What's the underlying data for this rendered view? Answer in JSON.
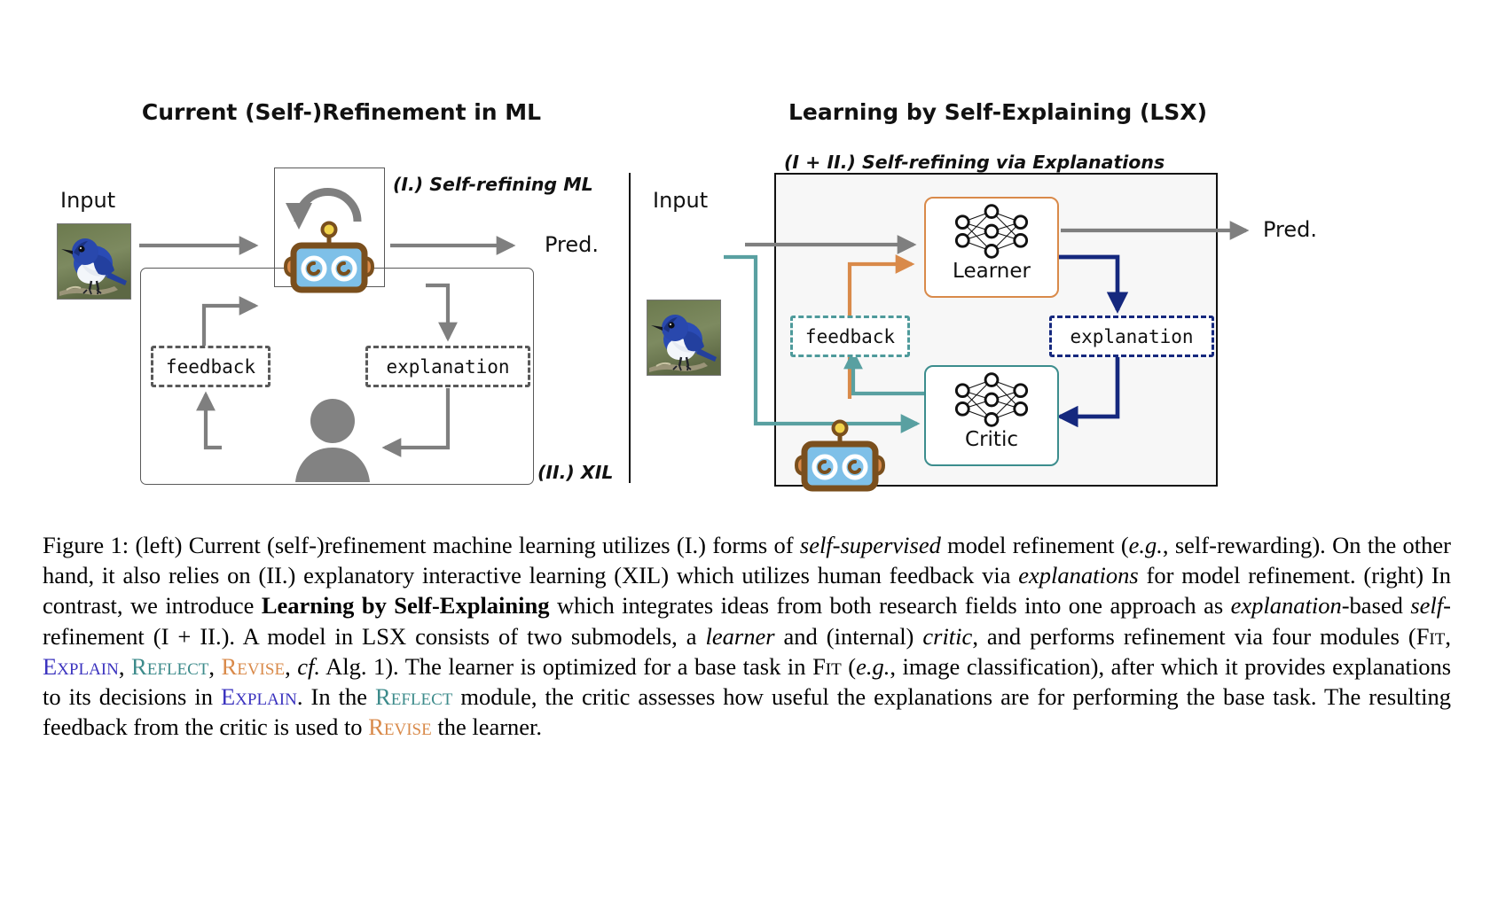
{
  "figure": {
    "left_panel": {
      "title": "Current (Self-)Refinement in ML",
      "input_label": "Input",
      "pred_label": "Pred.",
      "part_one_label": "(I.) Self-refining ML",
      "part_two_label": "(II.) XIL",
      "feedback_label": "feedback",
      "explanation_label": "explanation",
      "icons": {
        "model": "robot-icon",
        "human": "person-icon",
        "loop": "circular-refresh-arrow-icon",
        "input_image": "blue-flycatcher-bird-photo"
      }
    },
    "right_panel": {
      "title": "Learning by Self-Explaining (LSX)",
      "subtitle": "(I + II.) Self-refining via Explanations",
      "input_label": "Input",
      "pred_label": "Pred.",
      "learner_label": "Learner",
      "critic_label": "Critic",
      "feedback_label": "feedback",
      "explanation_label": "explanation",
      "icons": {
        "learner": "neural-network-icon",
        "critic": "neural-network-icon",
        "model": "robot-icon",
        "input_image": "blue-flycatcher-bird-photo"
      }
    },
    "colors": {
      "gray_arrow": "#7f7f7f",
      "orange": "#d98a4a",
      "teal": "#4e9a9b",
      "navy": "#15287e",
      "robot_body": "#7ec0e8",
      "robot_outline": "#7a4f1d",
      "robot_ear": "#d98a4a",
      "antenna_ball": "#f0d24a",
      "explain_color": "#3b33bf",
      "reflect_color": "#3d8b8b",
      "revise_color": "#d98a4a"
    }
  },
  "caption": {
    "label": "Figure 1:",
    "modules": {
      "fit": "Fit",
      "explain": "Explain",
      "reflect": "Reflect",
      "revise": "Revise"
    },
    "segments": [
      {
        "t": "Figure 1:",
        "s": "normal"
      },
      {
        "t": " (left) Current (self-)refinement machine learning utilizes (I.) forms of ",
        "s": "normal"
      },
      {
        "t": "self-supervised",
        "s": "italic"
      },
      {
        "t": " model refinement (",
        "s": "normal"
      },
      {
        "t": "e.g.",
        "s": "italic"
      },
      {
        "t": ", self-rewarding). On the other hand, it also relies on (II.) explanatory interactive learning (XIL) which utilizes human feedback via ",
        "s": "normal"
      },
      {
        "t": "explanations",
        "s": "italic"
      },
      {
        "t": " for model refinement. (right) In contrast, we introduce ",
        "s": "normal"
      },
      {
        "t": "Learning by Self-Explaining",
        "s": "bold"
      },
      {
        "t": " which integrates ideas from both research fields into one approach as ",
        "s": "normal"
      },
      {
        "t": "explanation",
        "s": "italic"
      },
      {
        "t": "-based ",
        "s": "normal"
      },
      {
        "t": "self",
        "s": "italic"
      },
      {
        "t": "-refinement (I + II.). A model in LSX consists of two submodels, a ",
        "s": "normal"
      },
      {
        "t": "learner",
        "s": "italic"
      },
      {
        "t": " and (internal) ",
        "s": "normal"
      },
      {
        "t": "critic",
        "s": "italic"
      },
      {
        "t": ", and performs refinement via four modules (",
        "s": "normal"
      },
      {
        "t": "Fit",
        "s": "smallcaps"
      },
      {
        "t": ", ",
        "s": "normal"
      },
      {
        "t": "Explain",
        "s": "smallcaps-explain"
      },
      {
        "t": ", ",
        "s": "normal"
      },
      {
        "t": "Reflect",
        "s": "smallcaps-reflect"
      },
      {
        "t": ", ",
        "s": "normal"
      },
      {
        "t": "Revise",
        "s": "smallcaps-revise"
      },
      {
        "t": ", ",
        "s": "normal"
      },
      {
        "t": "cf.",
        "s": "italic"
      },
      {
        "t": " Alg. 1). The learner is optimized for a base task in ",
        "s": "normal"
      },
      {
        "t": "Fit",
        "s": "smallcaps"
      },
      {
        "t": " (",
        "s": "normal"
      },
      {
        "t": "e.g.",
        "s": "italic"
      },
      {
        "t": ", image classification), after which it provides explanations to its decisions in ",
        "s": "normal"
      },
      {
        "t": "Explain",
        "s": "smallcaps-explain"
      },
      {
        "t": ". In the ",
        "s": "normal"
      },
      {
        "t": "Reflect",
        "s": "smallcaps-reflect"
      },
      {
        "t": " module, the critic assesses how useful the explanations are for performing the base task. The resulting feedback from the critic is used to ",
        "s": "normal"
      },
      {
        "t": "Revise",
        "s": "smallcaps-revise"
      },
      {
        "t": " the learner.",
        "s": "normal"
      }
    ]
  }
}
